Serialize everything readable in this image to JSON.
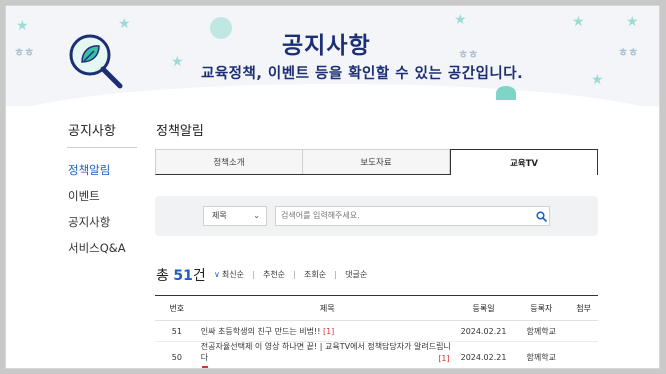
{
  "hero": {
    "title": "공지사항",
    "subtitle": "교육정책, 이벤트 등을 확인할 수 있는 공간입니다."
  },
  "sidebar": {
    "title": "공지사항",
    "items": [
      {
        "label": "정책알림",
        "active": true
      },
      {
        "label": "이벤트",
        "active": false
      },
      {
        "label": "공지사항",
        "active": false
      },
      {
        "label": "서비스Q&A",
        "active": false
      }
    ]
  },
  "main": {
    "title": "정책알림",
    "tabs": [
      {
        "label": "정책소개",
        "active": false
      },
      {
        "label": "보도자료",
        "active": false
      },
      {
        "label": "교육TV",
        "active": true
      }
    ],
    "search": {
      "select_value": "제목",
      "placeholder": "검색어를 입력해주세요."
    },
    "total_prefix": "총",
    "total_count": "51",
    "total_suffix": "건",
    "sorts": [
      "최신순",
      "추천순",
      "조회순",
      "댓글순"
    ],
    "table": {
      "headers": {
        "no": "번호",
        "title": "제목",
        "date": "등록일",
        "author": "등록자",
        "file": "첨부"
      },
      "rows": [
        {
          "no": "51",
          "title": "인싸 초등학생의 친구 만드는 비법!!",
          "badge": "[1]",
          "date": "2024.02.21",
          "author": "함께학교"
        },
        {
          "no": "50",
          "title": "전공자율선택제 이 영상 하나면 끝!  |  교육TV에서 정책담당자가 알려드립니다",
          "badge": "[1]",
          "date": "2024.02.21",
          "author": "함께학교"
        }
      ]
    }
  },
  "colors": {
    "accent": "#1a5fc9",
    "hero_text": "#1d2f74",
    "badge": "#dd3333"
  }
}
